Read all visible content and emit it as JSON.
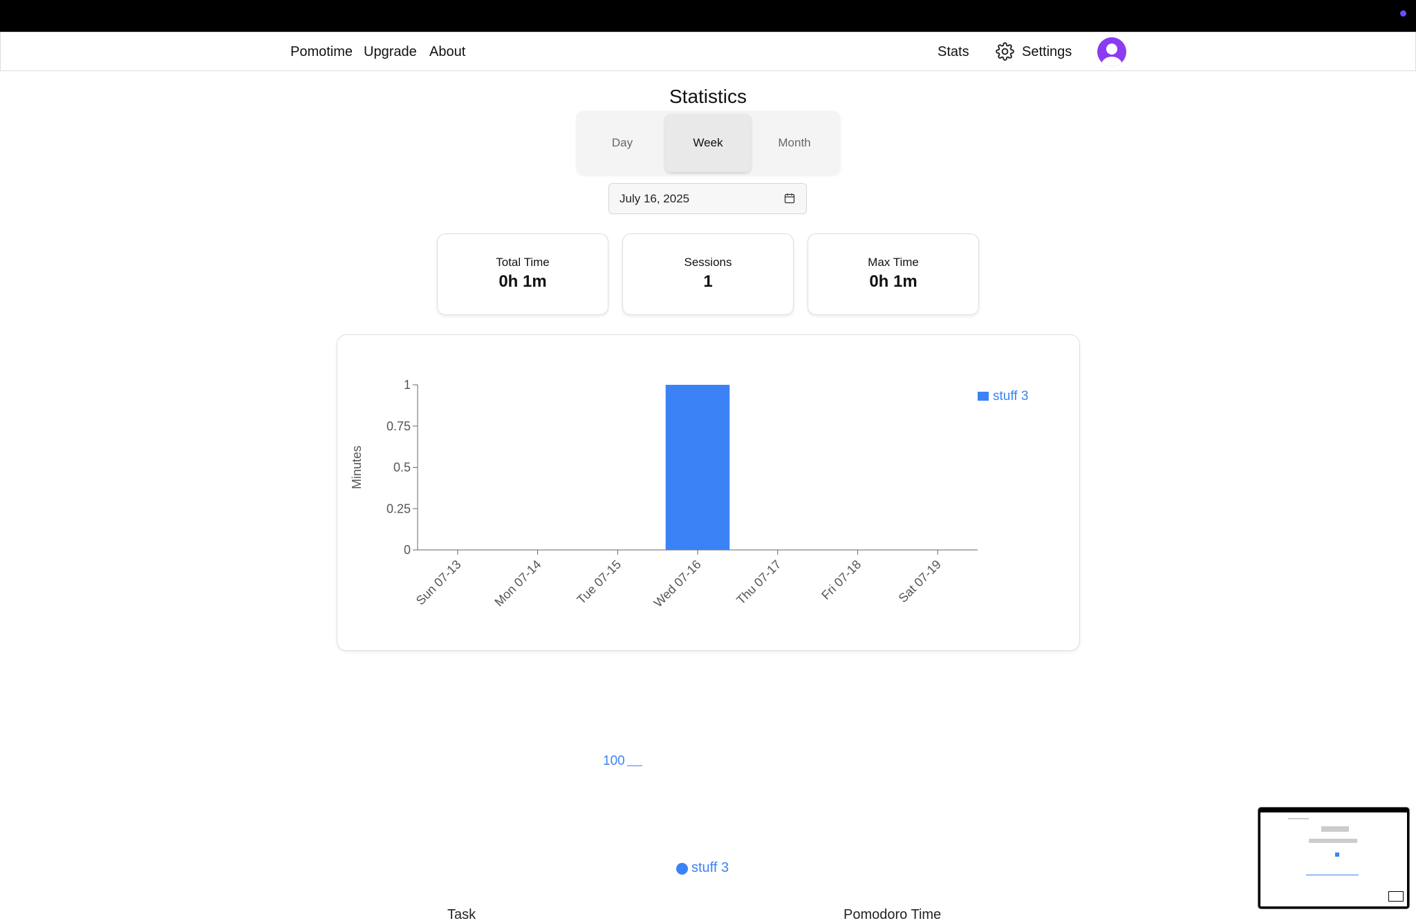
{
  "nav": {
    "brand": "Pomotime",
    "upgrade": "Upgrade",
    "about": "About",
    "stats": "Stats",
    "settings": "Settings"
  },
  "page": {
    "title": "Statistics"
  },
  "period_tabs": {
    "day": "Day",
    "week": "Week",
    "month": "Month",
    "selected": "Week"
  },
  "date_picker": {
    "value": "July 16, 2025",
    "icon": "calendar-icon"
  },
  "summary": [
    {
      "label": "Total Time",
      "value": "0h 1m"
    },
    {
      "label": "Sessions",
      "value": "1"
    },
    {
      "label": "Max Time",
      "value": "0h 1m"
    }
  ],
  "colors": {
    "accent": "#3b82f6",
    "avatar": "#8b3cf0",
    "topbar": "#000000"
  },
  "chart_data": {
    "type": "bar",
    "categories": [
      "Sun 07-13",
      "Mon 07-14",
      "Tue 07-15",
      "Wed 07-16",
      "Thu 07-17",
      "Fri 07-18",
      "Sat 07-19"
    ],
    "series": [
      {
        "name": "stuff 3",
        "values": [
          0,
          0,
          0,
          1,
          0,
          0,
          0
        ],
        "color": "#3b82f6"
      }
    ],
    "ylabel": "Minutes",
    "yticks": [
      "0",
      "0.25",
      "0.5",
      "0.75",
      "1"
    ],
    "ylim": [
      0,
      1
    ],
    "legend_position": "top-right"
  },
  "pie": {
    "value_label": "100",
    "legend_label": "stuff 3"
  },
  "partial_text": {
    "left": "Task",
    "right": "Pomodoro Time"
  }
}
